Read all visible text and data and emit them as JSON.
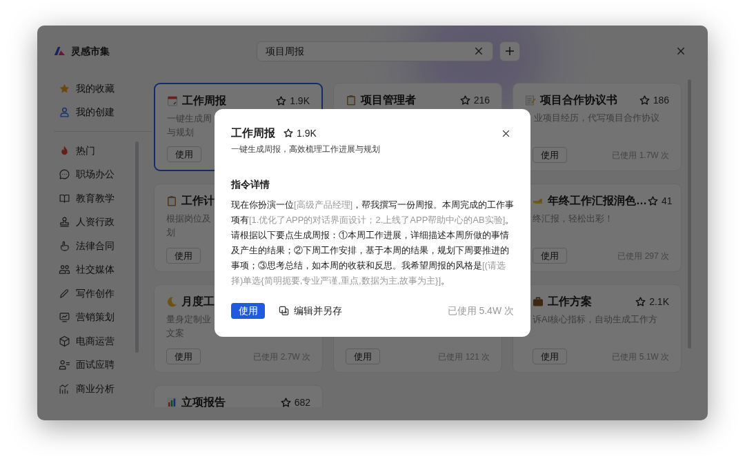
{
  "app": {
    "title": "灵感市集"
  },
  "search": {
    "value": "项目周报"
  },
  "sidebar": {
    "pinned": [
      {
        "label": "我的收藏"
      },
      {
        "label": "我的创建"
      }
    ],
    "categories": [
      {
        "label": "热门"
      },
      {
        "label": "职场办公"
      },
      {
        "label": "教育教学"
      },
      {
        "label": "人资行政"
      },
      {
        "label": "法律合同"
      },
      {
        "label": "社交媒体"
      },
      {
        "label": "写作创作"
      },
      {
        "label": "营销策划"
      },
      {
        "label": "电商运营"
      },
      {
        "label": "面试应聘"
      },
      {
        "label": "商业分析"
      }
    ]
  },
  "cards": [
    {
      "title": "工作周报",
      "favorites": "1.9K",
      "desc_lines": [
        "一键生成周",
        "与规划"
      ],
      "action": "使用",
      "selected": true
    },
    {
      "title": "项目管理者",
      "favorites": "216",
      "selected": false
    },
    {
      "title": "项目合作协议书",
      "favorites": "186",
      "desc_lines": [
        "业项目经历，代写项目合作协议"
      ],
      "action": "使用",
      "usage": "已使用 1.7W 次",
      "selected": false
    },
    {
      "title": "工作计",
      "desc_lines": [
        "根据岗位及",
        "划"
      ],
      "action": "使用",
      "selected": false
    },
    {
      "title": "年终工作汇报润色…",
      "favorites": "41",
      "desc_lines": [
        "终汇报，轻松出彩！"
      ],
      "action": "使用",
      "usage": "已使用 297 次",
      "selected": false
    },
    {
      "title": "月度工",
      "desc_lines": [
        "量身定制业",
        "文案"
      ],
      "action": "使用",
      "usage": "已使用 2.7W 次",
      "selected": false
    },
    {
      "action": "使用",
      "usage": "已使用 121 次",
      "selected": false
    },
    {
      "title": "工作方案",
      "favorites": "2.1K",
      "desc_lines": [
        "诉AI核心指标，自动生成工作方"
      ],
      "action": "使用",
      "usage": "已使用 5.1W 次",
      "selected": false
    },
    {
      "title": "立项报告",
      "favorites": "682",
      "selected": false
    }
  ],
  "dialog": {
    "title": "工作周报",
    "favorites": "1.9K",
    "subtitle": "一键生成周报，高效梳理工作进展与规划",
    "section_title": "指令详情",
    "prompt": [
      {
        "kind": "plain",
        "text": "现在你扮演一位"
      },
      {
        "kind": "variable",
        "text": "[高级产品经理]"
      },
      {
        "kind": "plain",
        "text": "，帮我撰写一份周报。本周完成的工作事项有"
      },
      {
        "kind": "variable",
        "text": "[1.优化了APP的对话界面设计；2.上线了APP帮助中心的AB实验]"
      },
      {
        "kind": "plain",
        "text": "。请根据以下要点生成周报：①本周工作进展，详细描述本周所做的事情及产生的结果；②下周工作安排，基于本周的结果，规划下周要推进的事项；③思考总结，如本周的收获和反思。我希望周报的风格是"
      },
      {
        "kind": "variable",
        "text": "[(请选择)单选{简明扼要,专业严谨,重点,数据为主,故事为主}]"
      },
      {
        "kind": "plain",
        "text": "。"
      }
    ],
    "primary_button": "使用",
    "secondary_button": "编辑并另存",
    "usage": "已使用 5.4W 次"
  }
}
